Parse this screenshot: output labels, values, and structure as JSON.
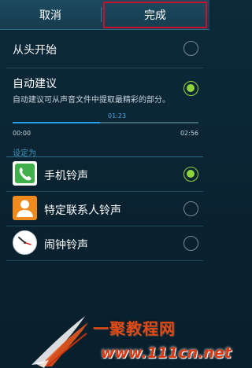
{
  "actionbar": {
    "cancel_label": "取消",
    "done_label": "完成"
  },
  "options": {
    "from_start": {
      "label": "从头开始",
      "selected": false
    },
    "auto_suggest": {
      "label": "自动建议",
      "description": "自动建议可从声音文件中提取最精彩的部分。",
      "selected": true
    }
  },
  "playback": {
    "time_start": "00:00",
    "time_current": "01:23",
    "time_end": "02:56",
    "progress_fraction": 0.47
  },
  "set_as": {
    "header": "设定为",
    "items": [
      {
        "label": "手机铃声",
        "icon": "phone-icon",
        "selected": true
      },
      {
        "label": "特定联系人铃声",
        "icon": "contact-icon",
        "selected": false
      },
      {
        "label": "闹钟铃声",
        "icon": "clock-icon",
        "selected": false
      }
    ]
  },
  "watermark": {
    "title": "一聚教程网",
    "url": "www.111cn.net"
  },
  "colors": {
    "accent_green": "#8fd43d",
    "progress_blue": "#2a9ef0",
    "highlight_red": "#c8102e"
  }
}
